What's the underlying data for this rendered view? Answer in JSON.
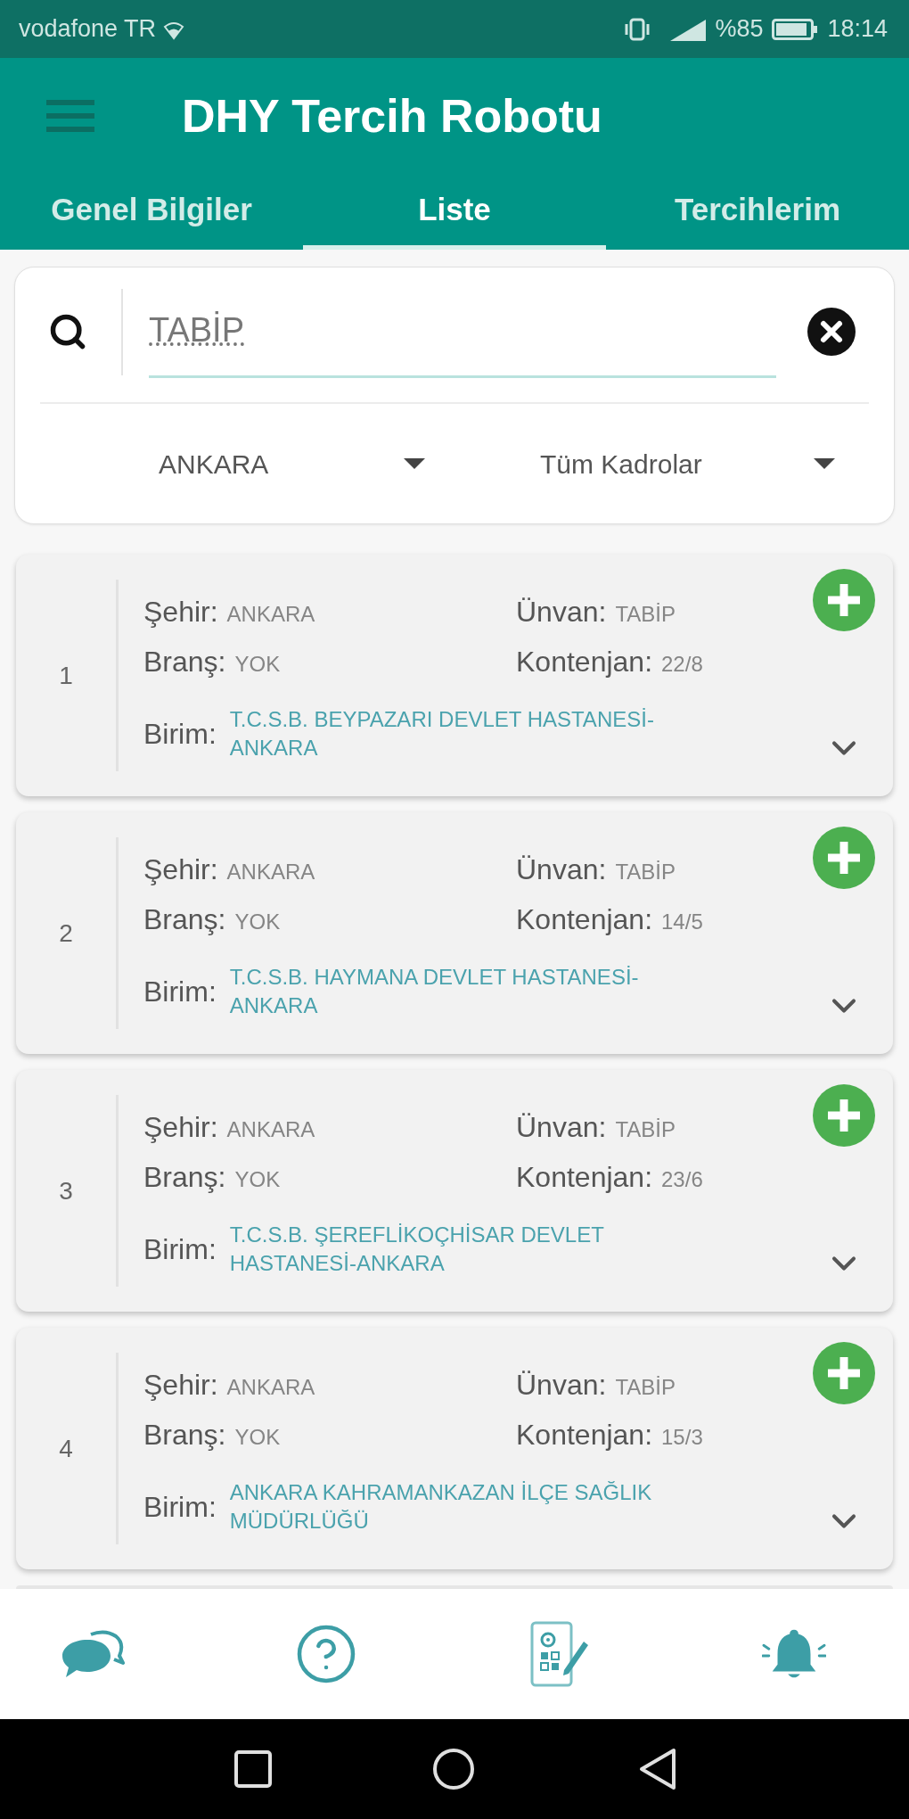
{
  "status_bar": {
    "carrier": "vodafone TR",
    "battery": "%85",
    "time": "18:14"
  },
  "app_bar": {
    "title": "DHY Tercih Robotu"
  },
  "tabs": [
    {
      "label": "Genel Bilgiler",
      "selected": false
    },
    {
      "label": "Liste",
      "selected": true
    },
    {
      "label": "Tercihlerim",
      "selected": false
    }
  ],
  "search": {
    "value": "TABİP"
  },
  "filters": [
    {
      "value": "ANKARA"
    },
    {
      "value": "Tüm Kadrolar"
    }
  ],
  "results": [
    {
      "number": "1",
      "fields": [
        {
          "label": "Şehir:",
          "value": "ANKARA"
        },
        {
          "label": "Ünvan:",
          "value": "TABİP"
        },
        {
          "label": "Branş:",
          "value": "YOK"
        },
        {
          "label": "Kontenjan:",
          "value": "22/8"
        }
      ],
      "unit": {
        "label": "Birim:",
        "value": "T.C.S.B. BEYPAZARI DEVLET HASTANESİ-ANKARA"
      }
    },
    {
      "number": "2",
      "fields": [
        {
          "label": "Şehir:",
          "value": "ANKARA"
        },
        {
          "label": "Ünvan:",
          "value": "TABİP"
        },
        {
          "label": "Branş:",
          "value": "YOK"
        },
        {
          "label": "Kontenjan:",
          "value": "14/5"
        }
      ],
      "unit": {
        "label": "Birim:",
        "value": "T.C.S.B. HAYMANA DEVLET HASTANESİ-ANKARA"
      }
    },
    {
      "number": "3",
      "fields": [
        {
          "label": "Şehir:",
          "value": "ANKARA"
        },
        {
          "label": "Ünvan:",
          "value": "TABİP"
        },
        {
          "label": "Branş:",
          "value": "YOK"
        },
        {
          "label": "Kontenjan:",
          "value": "23/6"
        }
      ],
      "unit": {
        "label": "Birim:",
        "value": "T.C.S.B. ŞEREFLİKOÇHİSAR DEVLET HASTANESİ-ANKARA"
      }
    },
    {
      "number": "4",
      "fields": [
        {
          "label": "Şehir:",
          "value": "ANKARA"
        },
        {
          "label": "Ünvan:",
          "value": "TABİP"
        },
        {
          "label": "Branş:",
          "value": "YOK"
        },
        {
          "label": "Kontenjan:",
          "value": "15/3"
        }
      ],
      "unit": {
        "label": "Birim:",
        "value": "ANKARA KAHRAMANKAZAN İLÇE SAĞLIK MÜDÜRLÜĞÜ"
      }
    }
  ]
}
